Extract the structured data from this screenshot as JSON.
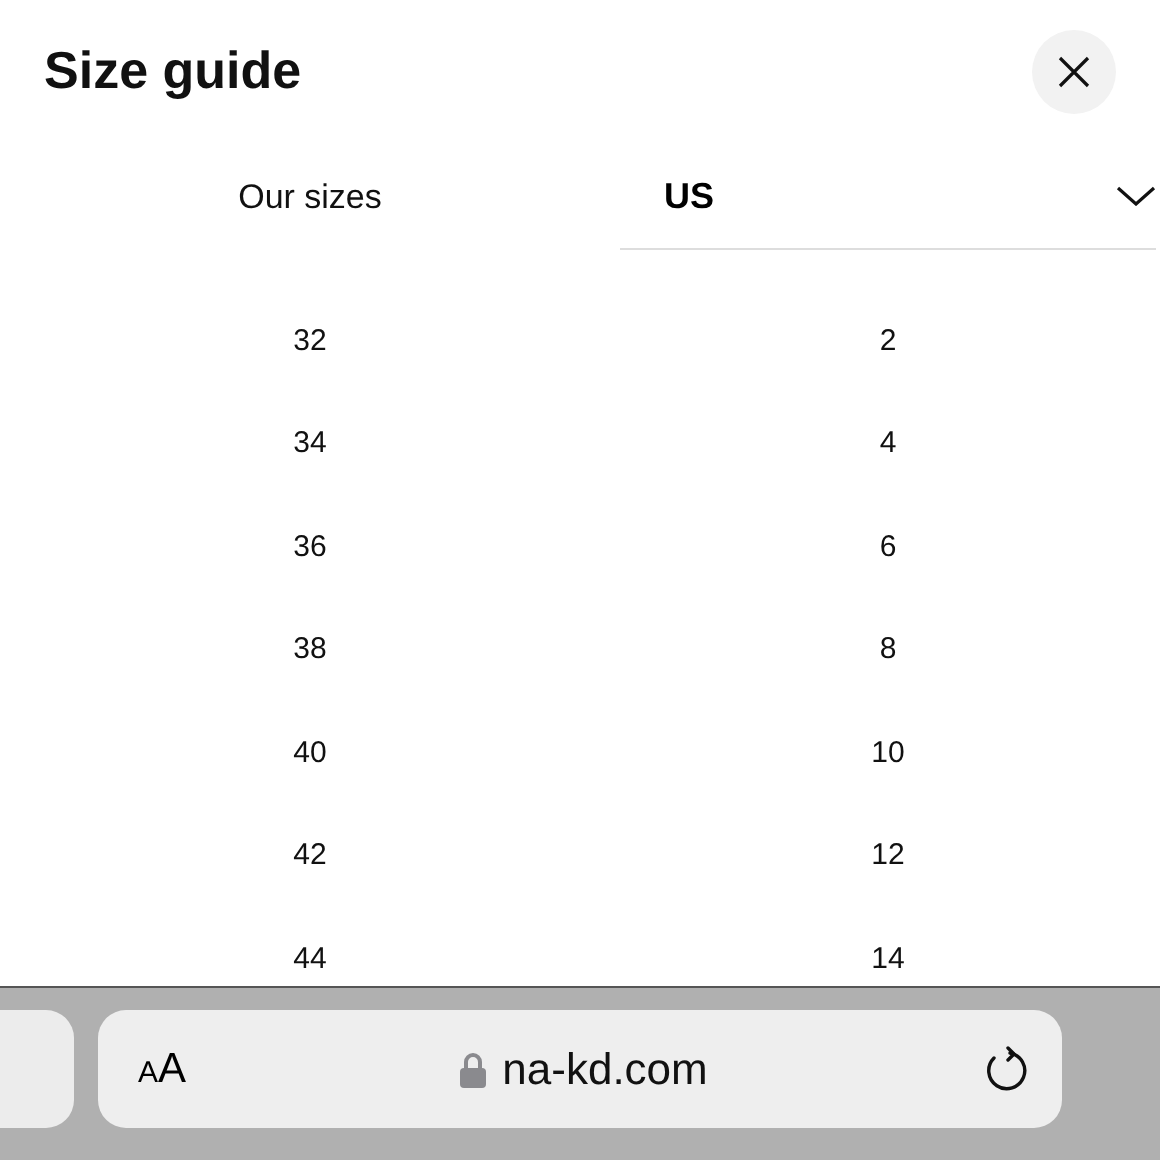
{
  "title": "Size guide",
  "columns": {
    "left": "Our sizes",
    "right": {
      "value": "US"
    }
  },
  "rows": [
    {
      "our": "32",
      "us": "2"
    },
    {
      "our": "34",
      "us": "4"
    },
    {
      "our": "36",
      "us": "6"
    },
    {
      "our": "38",
      "us": "8"
    },
    {
      "our": "40",
      "us": "10"
    },
    {
      "our": "42",
      "us": "12"
    },
    {
      "our": "44",
      "us": "14"
    }
  ],
  "browser_bar": {
    "text_size": "AA",
    "url": "na-kd.com"
  }
}
